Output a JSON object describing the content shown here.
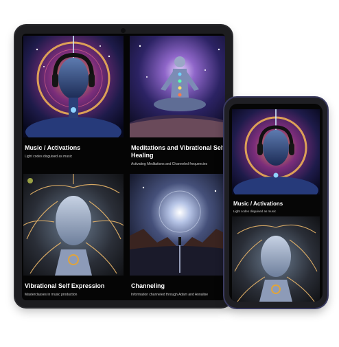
{
  "tablet": {
    "cards": [
      {
        "title": "Music / Activations",
        "subtitle": "Light codes disguised as music",
        "image": "headphones-cosmic-figure"
      },
      {
        "title": "Meditations and Vibrational Self Healing",
        "subtitle": "Activating Meditations and Channeled frequencies",
        "image": "meditating-figure"
      },
      {
        "title": "Vibrational Self Expression",
        "subtitle": "Masterclasses in music production",
        "image": "nerve-energy-face"
      },
      {
        "title": "Channeling",
        "subtitle": "Information channeled through Adam and Annalise",
        "image": "cosmic-portal-figure"
      }
    ]
  },
  "phone": {
    "cards": [
      {
        "title": "Music / Activations",
        "subtitle": "Light codes disguised as music",
        "image": "headphones-cosmic-figure"
      },
      {
        "title": "",
        "subtitle": "",
        "image": "nerve-energy-face"
      }
    ]
  },
  "colors": {
    "background": "#ffffff",
    "device_frame": "#1d1d20",
    "screen": "#050505",
    "text": "#ffffff",
    "subtext": "#cfcfcf"
  }
}
